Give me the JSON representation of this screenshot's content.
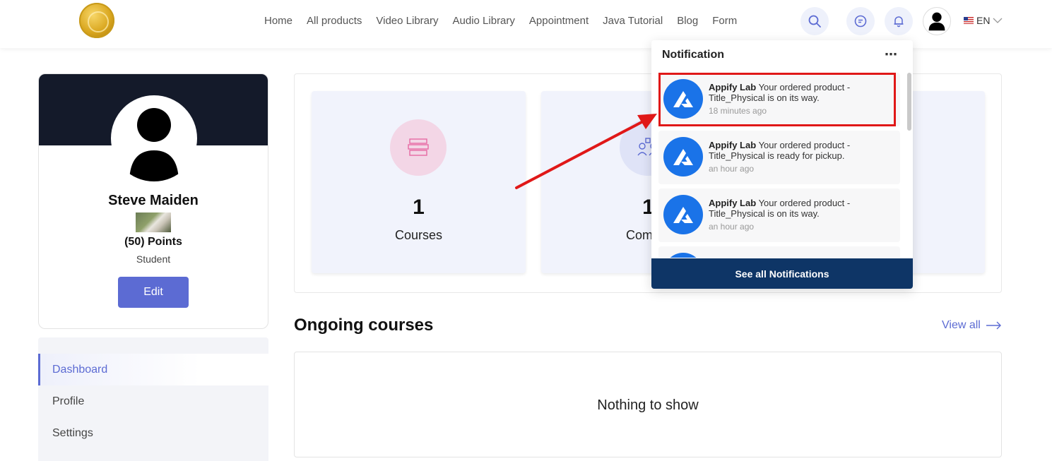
{
  "header": {
    "nav": [
      "Home",
      "All products",
      "Video Library",
      "Audio Library",
      "Appointment",
      "Java Tutorial",
      "Blog",
      "Form"
    ],
    "language": "EN",
    "icons": [
      "search-icon",
      "chat-icon",
      "bell-icon",
      "user-avatar-icon",
      "chevron-down-icon"
    ]
  },
  "profile": {
    "name": "Steve Maiden",
    "points": "(50) Points",
    "role": "Student",
    "edit_label": "Edit"
  },
  "side_menu": {
    "items": [
      "Dashboard",
      "Profile",
      "Settings"
    ]
  },
  "stats": [
    {
      "value": "1",
      "label": "Courses",
      "icon": "book-stack-icon"
    },
    {
      "value": "1",
      "label": "Commu",
      "icon": "community-icon"
    }
  ],
  "ongoing": {
    "title": "Ongoing courses",
    "view_all": "View all",
    "empty": "Nothing to show"
  },
  "notifications": {
    "title": "Notification",
    "more": "⋯",
    "items": [
      {
        "sender": "Appify Lab",
        "message": "Your ordered product - Title_Physical is on its way.",
        "time": "18 minutes ago"
      },
      {
        "sender": "Appify Lab",
        "message": "Your ordered product - Title_Physical is ready for pickup.",
        "time": "an hour ago"
      },
      {
        "sender": "Appify Lab",
        "message": "Your ordered product - Title_Physical is on its way.",
        "time": "an hour ago"
      }
    ],
    "footer": "See all Notifications"
  },
  "colors": {
    "accent": "#5c6bd3",
    "footer": "#0e3566",
    "highlight": "#e01818",
    "notif_logo": "#1a73e8"
  }
}
